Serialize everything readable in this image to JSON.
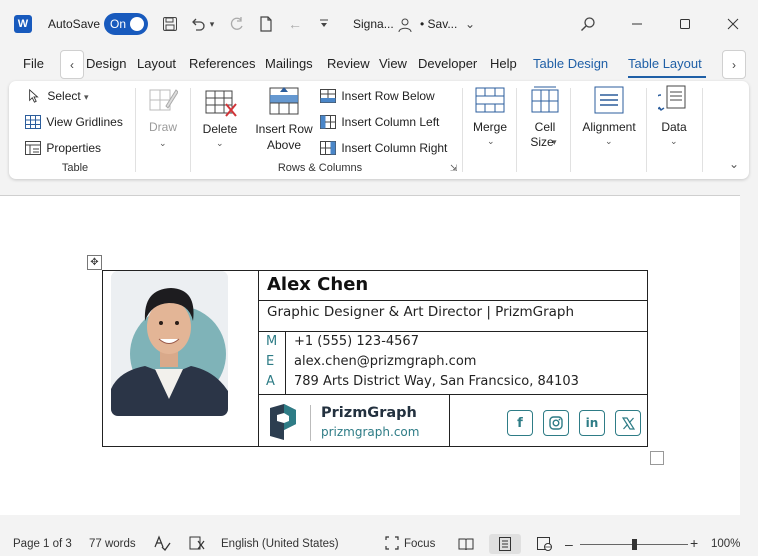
{
  "titlebar": {
    "app_letter": "W",
    "autosave_label": "AutoSave",
    "autosave_state": "On",
    "doc_title": "Signa...",
    "save_state": "• Sav...",
    "icons": [
      "save-icon",
      "undo-icon",
      "redo-icon",
      "new-doc-icon",
      "back-icon",
      "customize-icon",
      "search-icon",
      "minimize-icon",
      "maximize-icon",
      "close-icon"
    ]
  },
  "tabs": {
    "items": [
      "File",
      "Design",
      "Layout",
      "References",
      "Mailings",
      "Review",
      "View",
      "Developer",
      "Help"
    ],
    "contextual": [
      "Table Design",
      "Table Layout"
    ],
    "active": "Table Layout"
  },
  "ribbon": {
    "table": {
      "select_label": "Select",
      "gridlines_label": "View Gridlines",
      "properties_label": "Properties",
      "group_label": "Table"
    },
    "draw": {
      "label": "Draw"
    },
    "rows_columns": {
      "delete_label": "Delete",
      "insert_above_line1": "Insert Row",
      "insert_above_line2": "Above",
      "insert_below_label": "Insert Row Below",
      "insert_left_label": "Insert Column Left",
      "insert_right_label": "Insert Column Right",
      "group_label": "Rows & Columns"
    },
    "merge": {
      "label": "Merge"
    },
    "cell_size": {
      "line1": "Cell",
      "line2": "Size"
    },
    "alignment": {
      "label": "Alignment"
    },
    "data": {
      "label": "Data"
    }
  },
  "signature": {
    "name": "Alex Chen",
    "role": "Graphic Designer & Art Director | PrizmGraph",
    "contacts": [
      {
        "letter": "M",
        "value": "+1 (555) 123-4567"
      },
      {
        "letter": "E",
        "value": "alex.chen@prizmgraph.com"
      },
      {
        "letter": "A",
        "value": "789 Arts District Way, San Francsico, 84103"
      }
    ],
    "brand_name": "PrizmGraph",
    "brand_url": "prizmgraph.com",
    "socials": [
      "facebook-icon",
      "instagram-icon",
      "linkedin-icon",
      "x-icon"
    ],
    "accent_color": "#2e7c86"
  },
  "statusbar": {
    "page": "Page 1 of 3",
    "words": "77 words",
    "language": "English (United States)",
    "focus": "Focus",
    "zoom": "100%"
  }
}
